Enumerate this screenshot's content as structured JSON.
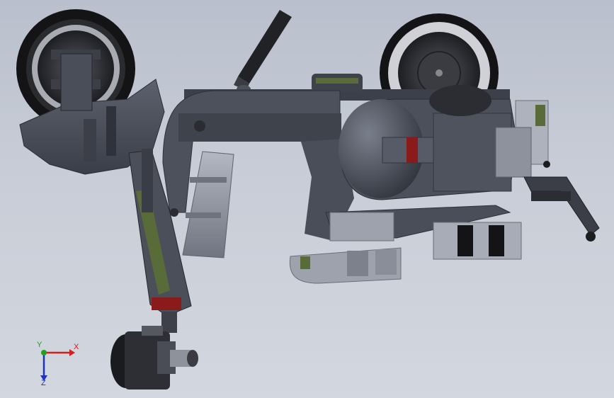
{
  "viewport": {
    "background_top": "#b9bfcc",
    "background_bottom": "#d3d7df"
  },
  "model": {
    "body_color": "#4a4f5a",
    "highlight_color": "#8a8f9c",
    "accent_green": "#5a6b3a",
    "accent_red": "#8b1a1a",
    "tire_color": "#1a1a1c"
  },
  "triad": {
    "x_label": "X",
    "y_label": "Y",
    "z_label": "Z",
    "x_color": "#d22020",
    "y_color": "#1fa01f",
    "z_color": "#2030c0"
  }
}
